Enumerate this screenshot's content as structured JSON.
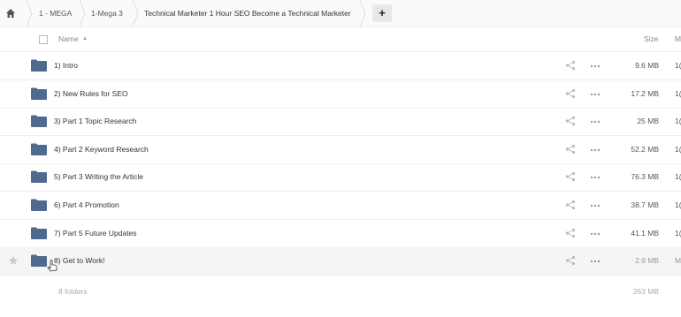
{
  "breadcrumb": {
    "home_icon": "home-icon",
    "items": [
      "1 - MEGA",
      "1-Mega 3",
      "Technical Marketer 1 Hour SEO Become a Technical Marketer"
    ],
    "add_label": "+"
  },
  "header": {
    "name_label": "Name",
    "size_label": "Size",
    "modified_label": "M"
  },
  "rows": [
    {
      "name": "1) Intro",
      "size": "9.6 MB",
      "modified": "1("
    },
    {
      "name": "2) New Rules for SEO",
      "size": "17.2 MB",
      "modified": "1("
    },
    {
      "name": "3) Part 1 Topic Research",
      "size": "25 MB",
      "modified": "1("
    },
    {
      "name": "4) Part 2 Keyword Research",
      "size": "52.2 MB",
      "modified": "1("
    },
    {
      "name": "5) Part 3 Writing the Article",
      "size": "76.3 MB",
      "modified": "1("
    },
    {
      "name": "6) Part 4 Promotion",
      "size": "38.7 MB",
      "modified": "1("
    },
    {
      "name": "7) Part 5 Future Updates",
      "size": "41.1 MB",
      "modified": "1("
    },
    {
      "name": "8) Get to Work!",
      "size": "2.9 MB",
      "modified": "M"
    }
  ],
  "footer": {
    "count": "8 folders",
    "total_size": "263 MB"
  },
  "colors": {
    "folder": "#4f6a8f",
    "row_hover": "#f5f5f5",
    "border": "#eeeeee"
  }
}
